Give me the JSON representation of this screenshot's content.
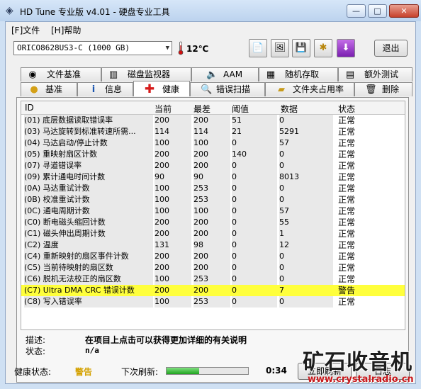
{
  "window": {
    "title": "HD Tune 专业版 v4.01 - 硬盘专业工具",
    "controls": {
      "minimize": "—",
      "maximize": "□",
      "close": "✕"
    }
  },
  "menu": [
    {
      "label": "[F]文件"
    },
    {
      "label": "[H]帮助"
    }
  ],
  "toolbar": {
    "drive": "ORICO8628US3-C (1000 GB)",
    "temperature": "12℃",
    "exit_label": "退出",
    "icons": [
      "copy-text-icon",
      "copy-screen-icon",
      "save-icon",
      "options-icon",
      "download-icon"
    ]
  },
  "tabs_row1": [
    {
      "label": "文件基准",
      "icon": "file-benchmark-icon"
    },
    {
      "label": "磁盘监视器",
      "icon": "disk-monitor-icon"
    },
    {
      "label": "AAM",
      "icon": "speaker-icon"
    },
    {
      "label": "随机存取",
      "icon": "random-access-icon"
    },
    {
      "label": "额外测试",
      "icon": "extra-tests-icon"
    }
  ],
  "tabs_row2": [
    {
      "label": "基准",
      "icon": "benchmark-icon"
    },
    {
      "label": "信息",
      "icon": "info-icon"
    },
    {
      "label": "健康",
      "icon": "health-cross-icon",
      "active": true
    },
    {
      "label": "错误扫描",
      "icon": "error-scan-icon"
    },
    {
      "label": "文件夹占用率",
      "icon": "folder-usage-icon"
    },
    {
      "label": "删除",
      "icon": "erase-icon"
    }
  ],
  "table": {
    "headers": {
      "id": "ID",
      "current": "当前",
      "worst": "最差",
      "threshold": "阈值",
      "data": "数据",
      "status": "状态"
    },
    "rows": [
      {
        "name": "(01) 底层数据读取错误率",
        "current": "200",
        "worst": "200",
        "threshold": "51",
        "data": "0",
        "status": "正常"
      },
      {
        "name": "(03) 马达旋转到标准转速所需...",
        "current": "114",
        "worst": "114",
        "threshold": "21",
        "data": "5291",
        "status": "正常"
      },
      {
        "name": "(04) 马达启动/停止计数",
        "current": "100",
        "worst": "100",
        "threshold": "0",
        "data": "57",
        "status": "正常"
      },
      {
        "name": "(05) 重映射扇区计数",
        "current": "200",
        "worst": "200",
        "threshold": "140",
        "data": "0",
        "status": "正常"
      },
      {
        "name": "(07) 寻道错误率",
        "current": "200",
        "worst": "200",
        "threshold": "0",
        "data": "0",
        "status": "正常"
      },
      {
        "name": "(09) 累计通电时间计数",
        "current": "90",
        "worst": "90",
        "threshold": "0",
        "data": "8013",
        "status": "正常"
      },
      {
        "name": "(0A) 马达重试计数",
        "current": "100",
        "worst": "253",
        "threshold": "0",
        "data": "0",
        "status": "正常"
      },
      {
        "name": "(0B) 校准重试计数",
        "current": "100",
        "worst": "253",
        "threshold": "0",
        "data": "0",
        "status": "正常"
      },
      {
        "name": "(0C) 通电周期计数",
        "current": "100",
        "worst": "100",
        "threshold": "0",
        "data": "57",
        "status": "正常"
      },
      {
        "name": "(C0) 断电磁头缩回计数",
        "current": "200",
        "worst": "200",
        "threshold": "0",
        "data": "55",
        "status": "正常"
      },
      {
        "name": "(C1) 磁头伸出周期计数",
        "current": "200",
        "worst": "200",
        "threshold": "0",
        "data": "1",
        "status": "正常"
      },
      {
        "name": "(C2) 温度",
        "current": "131",
        "worst": "98",
        "threshold": "0",
        "data": "12",
        "status": "正常"
      },
      {
        "name": "(C4) 重新映射的扇区事件计数",
        "current": "200",
        "worst": "200",
        "threshold": "0",
        "data": "0",
        "status": "正常"
      },
      {
        "name": "(C5) 当前待映射的扇区数",
        "current": "200",
        "worst": "200",
        "threshold": "0",
        "data": "0",
        "status": "正常"
      },
      {
        "name": "(C6) 脱机无法校正的扇区数",
        "current": "100",
        "worst": "253",
        "threshold": "0",
        "data": "0",
        "status": "正常"
      },
      {
        "name": "(C7) Ultra DMA CRC 错误计数",
        "current": "200",
        "worst": "200",
        "threshold": "0",
        "data": "7",
        "status": "警告",
        "warning": true
      },
      {
        "name": "(C8) 写入错误率",
        "current": "100",
        "worst": "253",
        "threshold": "0",
        "data": "0",
        "status": "正常"
      }
    ]
  },
  "description": {
    "label": "描述:",
    "value": "在项目上点击可以获得更加详细的有关说明"
  },
  "state": {
    "label": "状态:",
    "value": "n/a"
  },
  "footer": {
    "health_label": "健康状态:",
    "health_value": "警告",
    "next_refresh_label": "下次刷新:",
    "refresh_progress": 0.4,
    "countdown": "0:34",
    "refresh_button": "立即刷新",
    "log_button": "日志"
  },
  "watermark": {
    "text": "矿石收音机",
    "url": "www.crystalradio.cn"
  }
}
